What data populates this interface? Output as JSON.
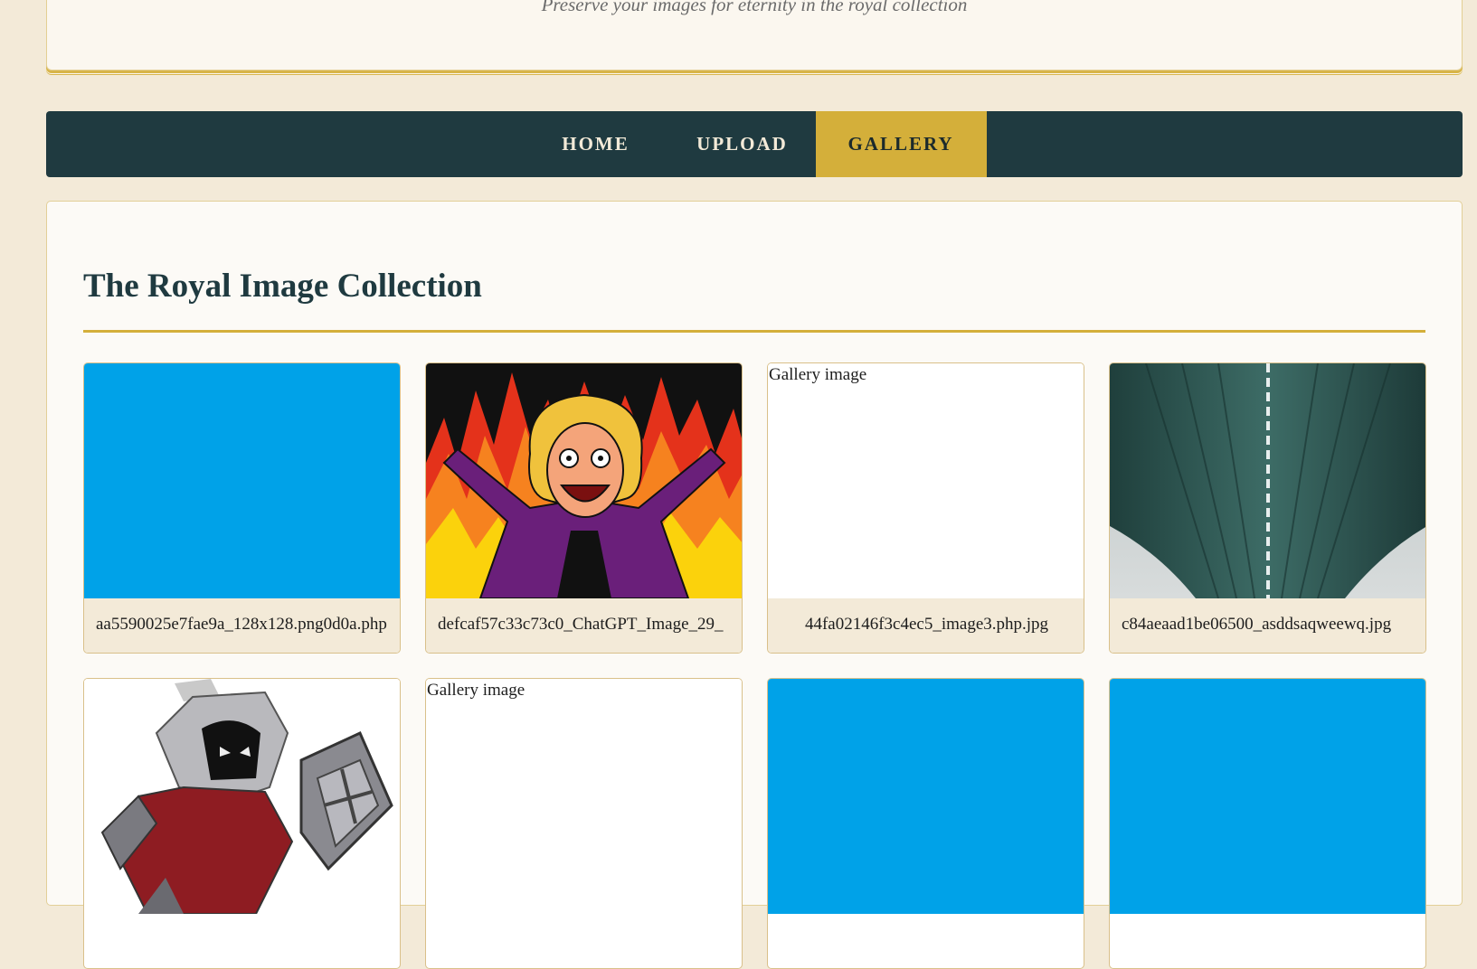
{
  "header": {
    "tagline": "Preserve your images for eternity in the royal collection"
  },
  "nav": {
    "items": [
      {
        "label": "Home"
      },
      {
        "label": "Upload"
      },
      {
        "label": "Gallery"
      }
    ]
  },
  "gallery": {
    "title": "The Royal Image Collection",
    "alt_text": "Gallery image",
    "cards": [
      {
        "filename": "aa5590025e7fae9a_128x128.png0d0a.php",
        "thumb": "blue-fill"
      },
      {
        "filename": "defcaf57c33c73c0_ChatGPT_Image_29_",
        "thumb": "cartoon-woman-flames"
      },
      {
        "filename": "44fa02146f3c4ec5_image3.php.jpg",
        "thumb": "broken-image"
      },
      {
        "filename": "c84aeaad1be06500_asddsaqweewq.jpg",
        "thumb": "bridge-underside"
      },
      {
        "filename": "",
        "thumb": "armored-character"
      },
      {
        "filename": "",
        "thumb": "broken-image"
      },
      {
        "filename": "",
        "thumb": "blue-fill"
      },
      {
        "filename": "",
        "thumb": "blue-fill"
      }
    ]
  },
  "colors": {
    "nav_bg": "#1f3a40",
    "accent_gold": "#d4af3a",
    "page_bg": "#f3ead8",
    "placeholder_blue": "#00a2e8"
  }
}
